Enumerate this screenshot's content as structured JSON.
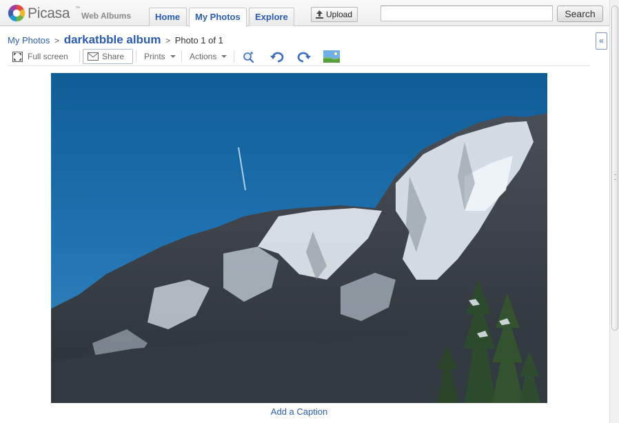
{
  "app": {
    "logo_word": "Picasa",
    "logo_trademark": "™",
    "logo_subtitle": "Web Albums",
    "accent": "#2a5db0"
  },
  "nav": {
    "tabs": [
      {
        "label": "Home",
        "active": false
      },
      {
        "label": "My Photos",
        "active": true
      },
      {
        "label": "Explore",
        "active": false
      }
    ],
    "upload_label": "Upload"
  },
  "search": {
    "value": "",
    "placeholder": "",
    "button_label": "Search"
  },
  "breadcrumb": {
    "root": "My Photos",
    "separator": ">",
    "album": "darkatbble album",
    "position": "Photo 1 of 1"
  },
  "toolbar": {
    "fullscreen_label": "Full screen",
    "share_label": "Share",
    "prints_label": "Prints",
    "actions_label": "Actions",
    "icons": [
      "zoom-in-icon",
      "rotate-left-icon",
      "rotate-right-icon",
      "set-background-icon"
    ]
  },
  "photo": {
    "subject": "snowy mountain under blue sky",
    "caption_link": "Add a Caption"
  },
  "side_panel": {
    "collapse_glyph": "«"
  }
}
